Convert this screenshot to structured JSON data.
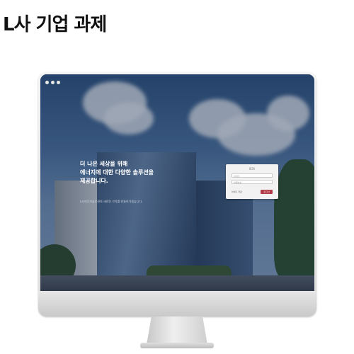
{
  "page": {
    "title": "L사 기업 과제"
  },
  "screen": {
    "window_controls": [
      "dot",
      "dot",
      "dot"
    ],
    "hero": {
      "line1": "더 나은 세상을 위해",
      "line2": "에너지에 대한 다양한 솔루션을",
      "line3": "제공합니다.",
      "subline": "L사에너지솔루션의 새로운 가치를 만들어가겠습니다."
    },
    "login": {
      "title": "로그인",
      "id_placeholder": "아이디",
      "pw_placeholder": "비밀번호",
      "remember_label": "아이디 저장",
      "submit_label": "로그인"
    }
  }
}
